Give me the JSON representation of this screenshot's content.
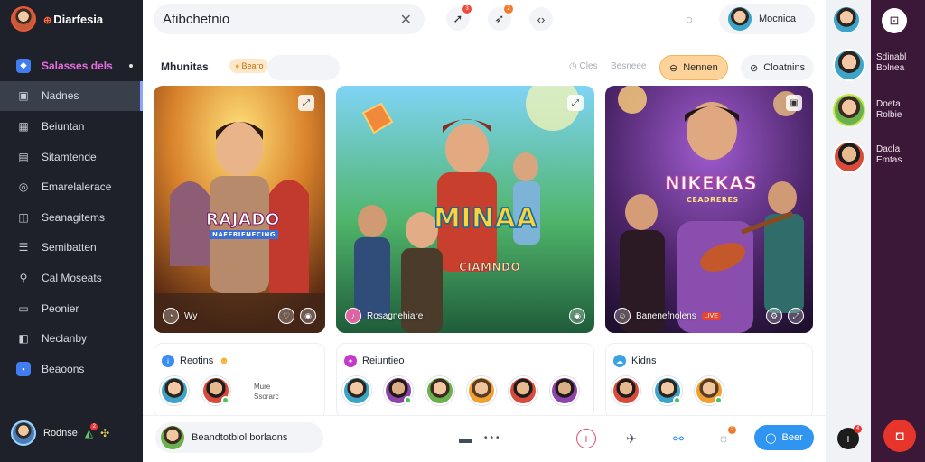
{
  "sidebar": {
    "brand": "Diarfesia",
    "items": [
      {
        "label": "Salasses dels",
        "icon": "shield-icon"
      },
      {
        "label": "Nadnes",
        "icon": "image-icon"
      },
      {
        "label": "Beiuntan",
        "icon": "grid-icon"
      },
      {
        "label": "Sitamtende",
        "icon": "calendar-icon"
      },
      {
        "label": "Emarelalerace",
        "icon": "globe-icon"
      },
      {
        "label": "Seanagitems",
        "icon": "layers-icon"
      },
      {
        "label": "Semibatten",
        "icon": "sliders-icon"
      },
      {
        "label": "Cal Moseats",
        "icon": "search-icon"
      },
      {
        "label": "Peonier",
        "icon": "folder-icon"
      },
      {
        "label": "Neclanby",
        "icon": "people-icon"
      },
      {
        "label": "Beaoons",
        "icon": "app-icon"
      }
    ],
    "footer_name": "Rodnse",
    "footer_badge": "2"
  },
  "topbar": {
    "search_value": "Atibchetnio",
    "btn1_badge": "3",
    "btn2_badge": "2",
    "user_name": "Mocnica"
  },
  "filters": {
    "title": "Mhunitas",
    "badge": "Bearo",
    "muted1": "Cles",
    "muted2": "Besneee",
    "active": "Nennen",
    "plain": "Cloatnins"
  },
  "cards": [
    {
      "title": "RAJADO",
      "subtitle": "NAFERIENFCING",
      "footer": "Wy"
    },
    {
      "title": "MINAA",
      "subtitle": "CIAMNDO",
      "footer": "Rosagnehiare"
    },
    {
      "title": "NIKEKAS",
      "subtitle": "CEADRERES",
      "footer": "Banenefnolens",
      "tag": "LIVE"
    }
  ],
  "groups": [
    {
      "title": "Reotins",
      "note1": "Mure",
      "note2": "Ssorarc"
    },
    {
      "title": "Reiuntieo"
    },
    {
      "title": "Kidns"
    }
  ],
  "bottombar": {
    "compose": "Beandtotbiol borlaons",
    "badge": "2",
    "start": "Beer",
    "plus_badge": "4"
  },
  "right_panel": {
    "items": [
      {
        "line1": "Sdinabl",
        "line2": "Bolnea"
      },
      {
        "line1": "Doeta",
        "line2": "Rolbie"
      },
      {
        "line1": "Daola",
        "line2": "Emtas"
      }
    ]
  }
}
